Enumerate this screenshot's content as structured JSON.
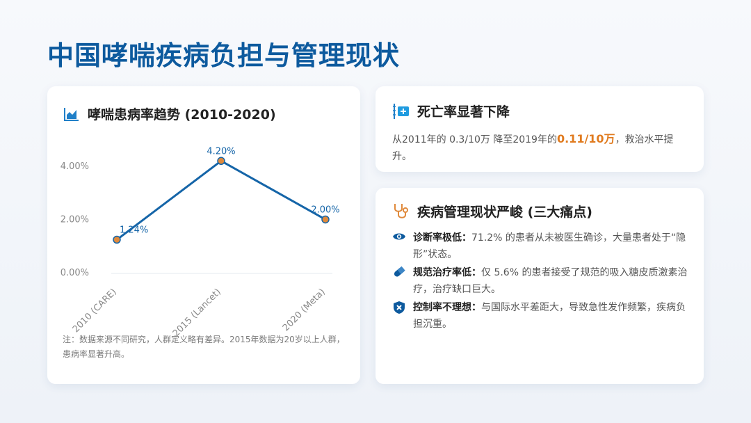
{
  "page": {
    "title": "中国哮喘疾病负担与管理现状"
  },
  "prevalence_card": {
    "icon": "area-chart-icon",
    "title": "哮喘患病率趋势 (2010-2020)",
    "note": "注：数据来源不同研究，人群定义略有差异。2015年数据为20岁以上人群，患病率显著升高。"
  },
  "chart_data": {
    "type": "line",
    "title": "",
    "xlabel": "",
    "ylabel": "",
    "categories": [
      "2010 (CARE)",
      "2015 (Lancet)",
      "2020 (Meta)"
    ],
    "series": [
      {
        "values": [
          1.24,
          4.2,
          2.0
        ]
      }
    ],
    "data_labels": [
      "1.24%",
      "4.20%",
      "2.00%"
    ],
    "y_ticks": [
      "0.00%",
      "2.00%",
      "4.00%"
    ],
    "y_tick_values": [
      0,
      2,
      4
    ],
    "ylim": [
      0,
      4.6
    ],
    "grid": false,
    "legend": "none",
    "colors": {
      "line": "#1565a8",
      "marker": "#e08a3c",
      "label": "#1565a8",
      "axis": "#888888"
    }
  },
  "mortality_card": {
    "icon": "mortality-chart-icon",
    "title": "死亡率显著下降",
    "text_before": "从2011年的 0.3/10万 降至2019年的",
    "highlight": "0.11/10万",
    "text_after": "，救治水平提升。"
  },
  "management_card": {
    "icon": "stethoscope-icon",
    "title": "疾病管理现状严峻 (三大痛点)",
    "items": [
      {
        "icon": "eye-icon",
        "title": "诊断率极低：",
        "text": "71.2% 的患者从未被医生确诊，大量患者处于“隐形”状态。"
      },
      {
        "icon": "pill-icon",
        "title": "规范治疗率低：",
        "text": "仅 5.6% 的患者接受了规范的吸入糖皮质激素治疗，治疗缺口巨大。"
      },
      {
        "icon": "shield-x-icon",
        "title": "控制率不理想：",
        "text": "与国际水平差距大，导致急性发作频繁，疾病负担沉重。"
      }
    ]
  },
  "colors": {
    "title": "#0d5a9e",
    "accent": "#1f7fc8",
    "highlight": "#e07b1f"
  }
}
